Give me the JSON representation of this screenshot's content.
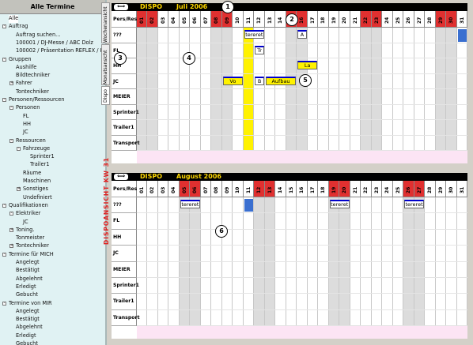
{
  "tree": {
    "title": "Alle Termine",
    "nodes": [
      {
        "label": "Alle",
        "level": 0,
        "box": ""
      },
      {
        "label": "Auftrag",
        "level": 0,
        "box": "-"
      },
      {
        "label": "Auftrag suchen...",
        "level": 1,
        "box": ""
      },
      {
        "label": "100001 / DJ-Messe / ABC Dolz",
        "level": 1,
        "box": ""
      },
      {
        "label": "100002 / Präsentation REFLEX / KW",
        "level": 1,
        "box": ""
      },
      {
        "label": "Gruppen",
        "level": 0,
        "box": "-"
      },
      {
        "label": "Aushilfe",
        "level": 1,
        "box": ""
      },
      {
        "label": "Bildtechniker",
        "level": 1,
        "box": ""
      },
      {
        "label": "Fahrer",
        "level": 1,
        "box": "+"
      },
      {
        "label": "Tontechniker",
        "level": 1,
        "box": ""
      },
      {
        "label": "Personen/Ressourcen",
        "level": 0,
        "box": "-"
      },
      {
        "label": "Personen",
        "level": 1,
        "box": "-"
      },
      {
        "label": "FL",
        "level": 2,
        "box": ""
      },
      {
        "label": "HH",
        "level": 2,
        "box": ""
      },
      {
        "label": "JC",
        "level": 2,
        "box": ""
      },
      {
        "label": "Ressourcen",
        "level": 1,
        "box": "-"
      },
      {
        "label": "Fahrzeuge",
        "level": 2,
        "box": "-"
      },
      {
        "label": "Sprinter1",
        "level": 3,
        "box": ""
      },
      {
        "label": "Trailer1",
        "level": 3,
        "box": ""
      },
      {
        "label": "Räume",
        "level": 2,
        "box": ""
      },
      {
        "label": "Maschinen",
        "level": 2,
        "box": ""
      },
      {
        "label": "Sonstiges",
        "level": 2,
        "box": "+"
      },
      {
        "label": "Undefiniert",
        "level": 2,
        "box": ""
      },
      {
        "label": "Qualifikationen",
        "level": 0,
        "box": "-"
      },
      {
        "label": "Elektriker",
        "level": 1,
        "box": "-"
      },
      {
        "label": "JC",
        "level": 2,
        "box": ""
      },
      {
        "label": "Toning.",
        "level": 1,
        "box": "+"
      },
      {
        "label": "Tonmeister",
        "level": 1,
        "box": ""
      },
      {
        "label": "Tontechniker",
        "level": 1,
        "box": "+"
      },
      {
        "label": "Termine für MICH",
        "level": 0,
        "box": "-"
      },
      {
        "label": "Angelegt",
        "level": 1,
        "box": ""
      },
      {
        "label": "Bestätigt",
        "level": 1,
        "box": ""
      },
      {
        "label": "Abgelehnt",
        "level": 1,
        "box": ""
      },
      {
        "label": "Erledigt",
        "level": 1,
        "box": ""
      },
      {
        "label": "Gebucht",
        "level": 1,
        "box": ""
      },
      {
        "label": "Termine von MIR",
        "level": 0,
        "box": "-"
      },
      {
        "label": "Angelegt",
        "level": 1,
        "box": ""
      },
      {
        "label": "Bestätigt",
        "level": 1,
        "box": ""
      },
      {
        "label": "Abgelehnt",
        "level": 1,
        "box": ""
      },
      {
        "label": "Erledigt",
        "level": 1,
        "box": ""
      },
      {
        "label": "Gebucht",
        "level": 1,
        "box": ""
      }
    ]
  },
  "tabs": [
    "Wochenansicht",
    "Monatsansicht",
    "Dispo"
  ],
  "side_label": "DISPOANSICHT KW 31",
  "nav_arrow": "⟺",
  "calendars": [
    {
      "title": "DISPO",
      "month": "Juli 2006",
      "header_label": "Pers/Res",
      "days": [
        "01",
        "02",
        "03",
        "04",
        "05",
        "06",
        "07",
        "08",
        "09",
        "10",
        "11",
        "12",
        "13",
        "14",
        "15",
        "16",
        "17",
        "18",
        "19",
        "20",
        "21",
        "22",
        "23",
        "24",
        "25",
        "26",
        "27",
        "28",
        "29",
        "30",
        "31"
      ],
      "weekends": [
        0,
        1,
        7,
        8,
        14,
        15,
        21,
        22,
        28,
        29
      ],
      "rows": [
        "???",
        "FL",
        "HH",
        "JC",
        "MEIER",
        "Sprinter1",
        "Trailer1",
        "Transport"
      ],
      "events": [
        {
          "row": 0,
          "start": 10,
          "end": 11,
          "label": "tereret",
          "yellow": false
        },
        {
          "row": 0,
          "start": 15,
          "end": 15,
          "label": "A",
          "yellow": false
        },
        {
          "row": 1,
          "start": 11,
          "end": 11,
          "label": "Tr",
          "yellow": false
        },
        {
          "row": 2,
          "start": 15,
          "end": 16,
          "label": "La",
          "yellow": true
        },
        {
          "row": 3,
          "start": 8,
          "end": 9,
          "label": "Vo",
          "yellow": true
        },
        {
          "row": 3,
          "start": 11,
          "end": 11,
          "label": "B",
          "yellow": false
        },
        {
          "row": 3,
          "start": 12,
          "end": 14,
          "label": "Aufbau",
          "yellow": true
        }
      ],
      "highlight_col": 10,
      "blue_col": 30
    },
    {
      "title": "DISPO",
      "month": "August 2006",
      "header_label": "Pers/Res",
      "days": [
        "01",
        "02",
        "03",
        "04",
        "05",
        "06",
        "07",
        "08",
        "09",
        "10",
        "11",
        "12",
        "13",
        "14",
        "15",
        "16",
        "17",
        "18",
        "19",
        "20",
        "21",
        "22",
        "23",
        "24",
        "25",
        "26",
        "27",
        "28",
        "29",
        "30",
        "31"
      ],
      "weekends": [
        4,
        5,
        11,
        12,
        18,
        19,
        25,
        26
      ],
      "rows": [
        "???",
        "FL",
        "HH",
        "JC",
        "MEIER",
        "Sprinter1",
        "Trailer1",
        "Transport"
      ],
      "events": [
        {
          "row": 0,
          "start": 4,
          "end": 5,
          "label": "tereret",
          "yellow": false
        },
        {
          "row": 0,
          "start": 18,
          "end": 19,
          "label": "tereret",
          "yellow": false
        },
        {
          "row": 0,
          "start": 25,
          "end": 26,
          "label": "tereret",
          "yellow": false
        }
      ],
      "highlight_col": -1,
      "blue_col": 10
    }
  ],
  "callouts": [
    "1",
    "2",
    "3",
    "4",
    "5",
    "6"
  ],
  "colors": {
    "weekend_head": "#e03030",
    "weekend_col": "#dcdcdc",
    "highlight": "#fff200",
    "event_border": "#0000cc",
    "blue": "#3a6fd0"
  }
}
